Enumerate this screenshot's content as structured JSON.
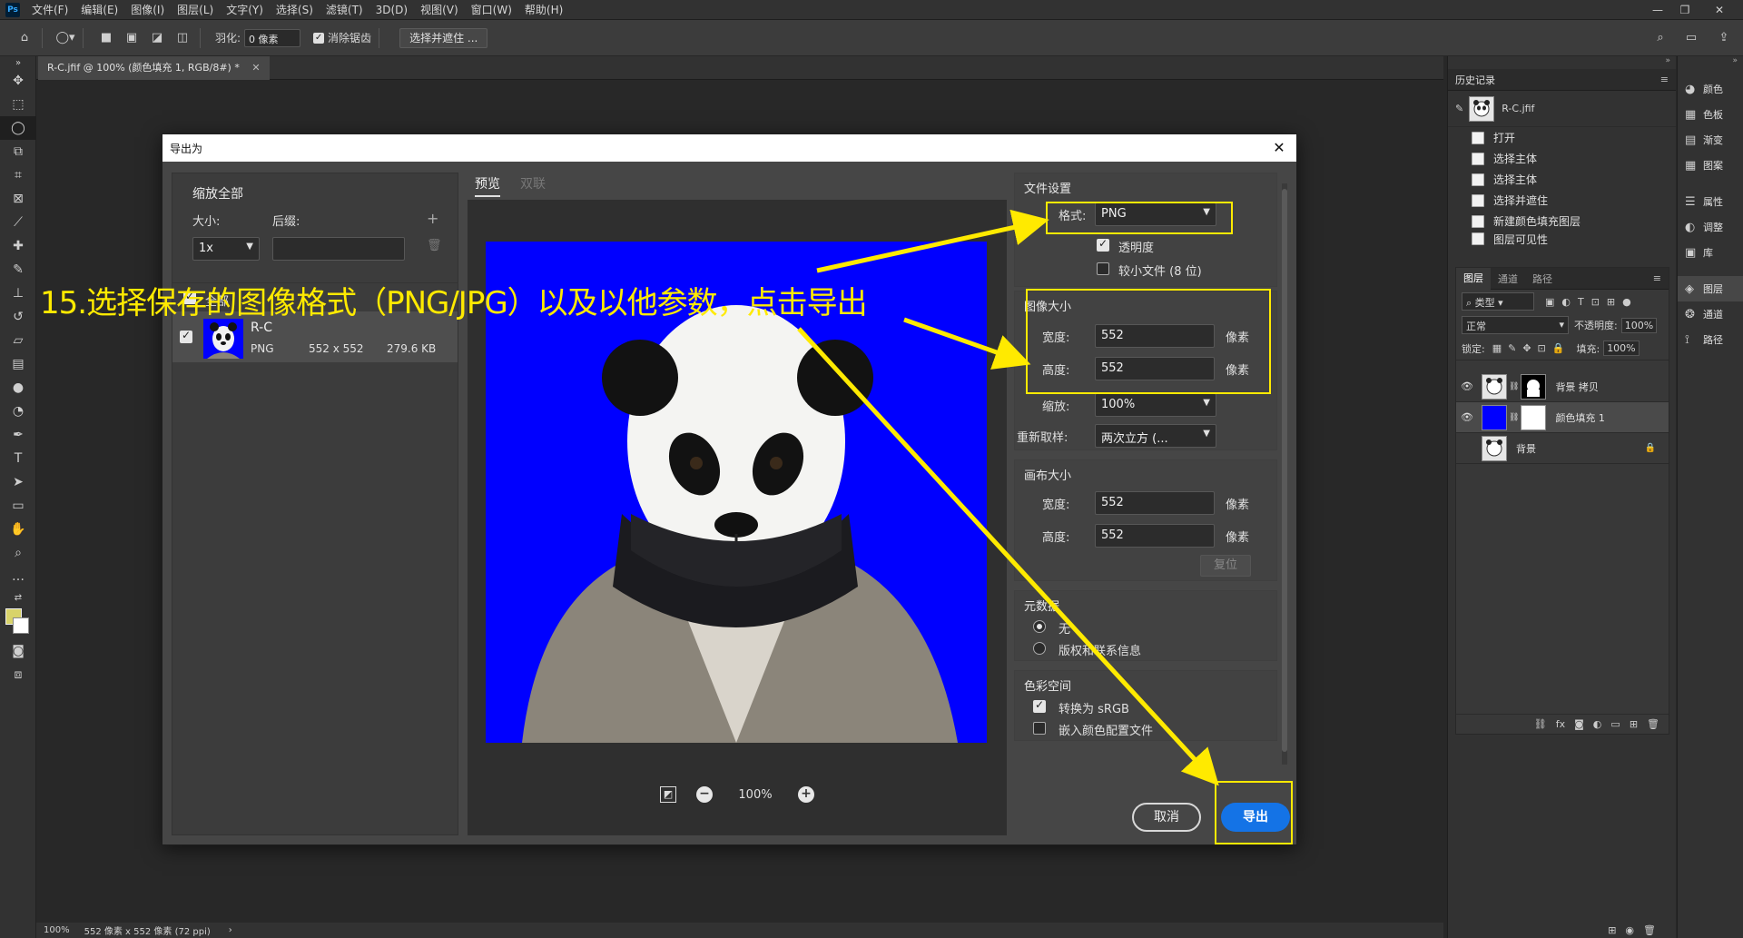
{
  "menubar": {
    "items": [
      "文件(F)",
      "编辑(E)",
      "图像(I)",
      "图层(L)",
      "文字(Y)",
      "选择(S)",
      "滤镜(T)",
      "3D(D)",
      "视图(V)",
      "窗口(W)",
      "帮助(H)"
    ]
  },
  "options": {
    "feather_label": "羽化:",
    "feather_value": "0 像素",
    "antialias_label": "消除锯齿",
    "select_mask_button": "选择并遮住 ..."
  },
  "document": {
    "tab_title": "R-C.jfif @ 100% (颜色填充 1, RGB/8#) *",
    "zoom": "100%",
    "status": "552 像素 x 552 像素 (72 ppi)"
  },
  "history": {
    "title": "历史记录",
    "snapshot": "R-C.jfif",
    "items": [
      "打开",
      "选择主体",
      "选择主体",
      "选择并遮住",
      "新建颜色填充图层",
      "图层可见性"
    ]
  },
  "layers": {
    "tabs": [
      "图层",
      "通道",
      "路径"
    ],
    "filter_label": "类型",
    "blend_mode": "正常",
    "opacity_label": "不透明度:",
    "opacity_value": "100%",
    "lock_label": "锁定:",
    "fill_label": "填充:",
    "fill_value": "100%",
    "items": [
      {
        "name": "背景 拷贝"
      },
      {
        "name": "颜色填充 1"
      },
      {
        "name": "背景"
      }
    ]
  },
  "dock": {
    "group1": [
      "颜色",
      "色板",
      "渐变",
      "图案"
    ],
    "group2": [
      "属性",
      "调整",
      "库"
    ],
    "group3": [
      "图层",
      "通道",
      "路径"
    ]
  },
  "dialog": {
    "title": "导出为",
    "left": {
      "scale_all": "缩放全部",
      "size_label": "大小:",
      "suffix_label": "后缀:",
      "size_value": "1x",
      "select_all": "全部",
      "asset_name": "R-C",
      "asset_format": "PNG",
      "asset_dims": "552 x 552",
      "asset_size": "279.6 KB"
    },
    "preview": {
      "tabs": [
        "预览",
        "双联"
      ],
      "zoom": "100%"
    },
    "file_settings": {
      "title": "文件设置",
      "format_label": "格式:",
      "format_value": "PNG",
      "transparency_label": "透明度",
      "smaller_file_label": "较小文件 (8 位)"
    },
    "image_size": {
      "title": "图像大小",
      "width_label": "宽度:",
      "width_value": "552",
      "height_label": "高度:",
      "height_value": "552",
      "unit": "像素",
      "scale_label": "缩放:",
      "scale_value": "100%",
      "resample_label": "重新取样:",
      "resample_value": "两次立方 (..."
    },
    "canvas_size": {
      "title": "画布大小",
      "width_label": "宽度:",
      "width_value": "552",
      "height_label": "高度:",
      "height_value": "552",
      "unit": "像素",
      "reset_button": "复位"
    },
    "metadata": {
      "title": "元数据",
      "option_none": "无",
      "option_copyright": "版权和联系信息"
    },
    "color_space": {
      "title": "色彩空间",
      "convert_srgb": "转换为 sRGB",
      "embed_profile": "嵌入颜色配置文件"
    },
    "cancel_button": "取消",
    "export_button": "导出"
  },
  "annotation": "15.选择保存的图像格式（PNG/JPG）以及以他参数，点击导出",
  "colors": {
    "accent_yellow": "#ffea00",
    "export_blue": "#1473e6",
    "preview_bg": "#0000ff"
  }
}
